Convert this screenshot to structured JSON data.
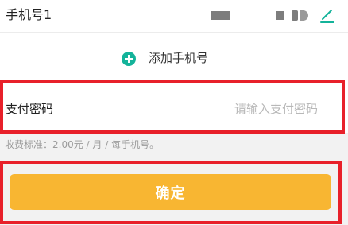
{
  "phone_row": {
    "label": "手机号1",
    "edit_icon": "edit-pencil-icon"
  },
  "add_phone": {
    "label": "添加手机号",
    "icon": "plus-circle-icon",
    "icon_color": "#14b39a"
  },
  "payment_password": {
    "label": "支付密码",
    "placeholder": "请输入支付密码",
    "value": ""
  },
  "fee_note": "收费标准：2.00元 / 月 / 每手机号。",
  "confirm_button": {
    "label": "确定",
    "color": "#f8b632"
  },
  "highlight_color": "#e8202a"
}
